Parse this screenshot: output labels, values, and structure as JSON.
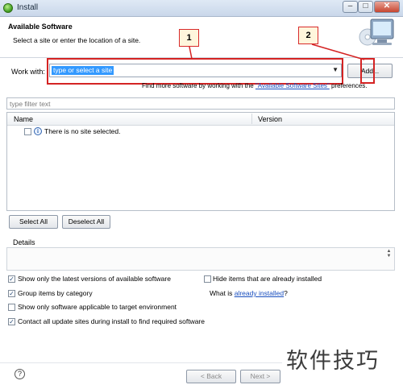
{
  "window": {
    "title": "Install",
    "minimize_glyph": "–",
    "maximize_glyph": "□",
    "close_glyph": "✕"
  },
  "header": {
    "heading": "Available Software",
    "subheading": "Select a site or enter the location of a site."
  },
  "callouts": {
    "one": "1",
    "two": "2"
  },
  "work_with": {
    "label": "Work with:",
    "value": "type or select a site",
    "add_label": "Add...",
    "more_prefix": "Find more software by working with the ",
    "more_link": "\"Available Software Sites\"",
    "more_suffix": " preferences."
  },
  "filter": {
    "placeholder": "type filter text"
  },
  "table": {
    "columns": [
      "Name",
      "Version"
    ],
    "empty_message": "There is no site selected."
  },
  "buttons": {
    "select_all": "Select All",
    "deselect_all": "Deselect All",
    "back": "< Back",
    "next": "Next >"
  },
  "details": {
    "label": "Details"
  },
  "options": {
    "latest": {
      "label": "Show only the latest versions of available software",
      "checked": true
    },
    "hide_installed": {
      "label": "Hide items that are already installed",
      "checked": false
    },
    "group": {
      "label": "Group items by category",
      "checked": true
    },
    "target": {
      "label": "Show only software applicable to target environment",
      "checked": false
    },
    "contact": {
      "label": "Contact all update sites during install to find required software",
      "checked": true
    },
    "whatis_prefix": "What is ",
    "whatis_link": "already installed",
    "whatis_suffix": "?"
  },
  "watermark": "软件技巧",
  "icons": [
    "app-icon",
    "monitor-icon",
    "info-icon",
    "help-icon",
    "combo-arrow-icon"
  ],
  "colors": {
    "highlight": "#d42323",
    "selection": "#3399ff",
    "link": "#1a4fbf"
  }
}
